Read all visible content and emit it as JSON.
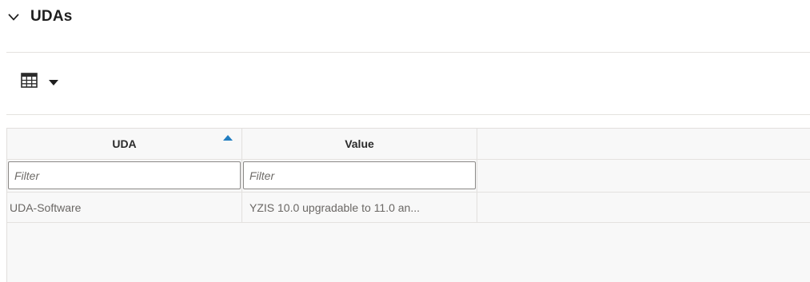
{
  "section": {
    "title": "UDAs",
    "expanded": true
  },
  "toolbar": {
    "view_icon": "table-grid-icon",
    "view_dropdown_icon": "caret-down-icon"
  },
  "table": {
    "columns": [
      {
        "label": "UDA",
        "sorted": "ascending"
      },
      {
        "label": "Value"
      }
    ],
    "filters": [
      {
        "placeholder": "Filter",
        "value": ""
      },
      {
        "placeholder": "Filter",
        "value": ""
      }
    ],
    "rows": [
      [
        "UDA-Software",
        "YZIS 10.0 upgradable to 11.0 an..."
      ]
    ]
  },
  "colors": {
    "sort_indicator": "#227ec1",
    "divider": "#e4e2df",
    "grid_background": "#f8f8f8"
  }
}
